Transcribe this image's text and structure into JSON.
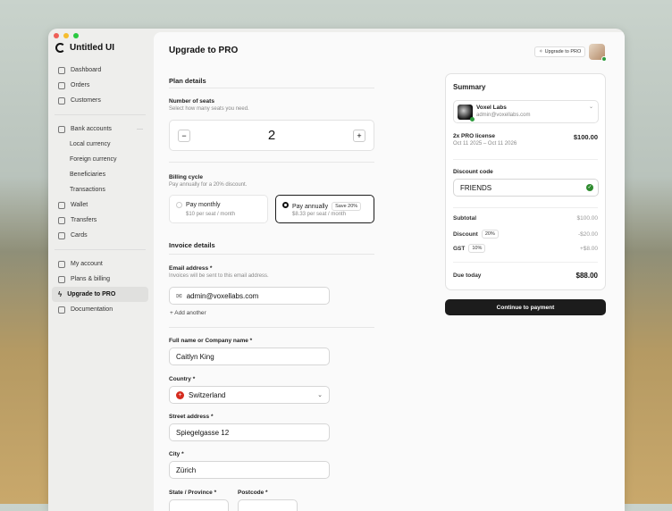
{
  "app": {
    "name": "Untitled UI"
  },
  "sidebar": {
    "items": [
      {
        "label": "Dashboard"
      },
      {
        "label": "Orders"
      },
      {
        "label": "Customers"
      },
      {
        "label": "Bank accounts"
      },
      {
        "label": "Local currency"
      },
      {
        "label": "Foreign currency"
      },
      {
        "label": "Beneficiaries"
      },
      {
        "label": "Transactions"
      },
      {
        "label": "Wallet"
      },
      {
        "label": "Transfers"
      },
      {
        "label": "Cards"
      },
      {
        "label": "My account"
      },
      {
        "label": "Plans & billing"
      },
      {
        "label": "Upgrade to PRO"
      },
      {
        "label": "Documentation"
      }
    ]
  },
  "header": {
    "title": "Upgrade to PRO",
    "upgrade_button": "Upgrade to PRO"
  },
  "plan": {
    "heading": "Plan details",
    "seats_label": "Number of seats",
    "seats_hint": "Select how many seats you need.",
    "seats": "2",
    "minus": "−",
    "plus": "+",
    "billing_label": "Billing cycle",
    "billing_hint": "Pay annually for a 20% discount.",
    "monthly": {
      "title": "Pay monthly",
      "price": "$10 per seat / month"
    },
    "annual": {
      "title": "Pay annually",
      "badge": "Save 20%",
      "price": "$8.33 per seat / month"
    }
  },
  "invoice": {
    "heading": "Invoice details",
    "email_label": "Email address *",
    "email_hint": "Invoices will be sent to this email address.",
    "email": "admin@voxellabs.com",
    "add_another": "Add another",
    "name_label": "Full name or Company name *",
    "name": "Caitlyn King",
    "country_label": "Country *",
    "country": "Switzerland",
    "street_label": "Street address *",
    "street": "Spiegelgasse 12",
    "city_label": "City *",
    "city": "Zürich",
    "state_label": "State / Province *",
    "postcode_label": "Postcode *"
  },
  "summary": {
    "title": "Summary",
    "org": "Voxel Labs",
    "org_email": "admin@voxellabs.com",
    "license": "2x PRO license",
    "license_dates": "Oct 11 2025 – Oct 11 2026",
    "license_price": "$100.00",
    "discount_label": "Discount code",
    "discount_code": "FRIENDS",
    "subtotal_label": "Subtotal",
    "subtotal": "$100.00",
    "discount_row": "Discount",
    "discount_badge": "20%",
    "discount": "-$20.00",
    "gst_label": "GST",
    "gst_badge": "10%",
    "gst": "+$8.00",
    "due_label": "Due today",
    "due": "$88.00",
    "continue": "Continue to payment"
  },
  "colors": {
    "accent": "#1c1c1c",
    "success": "#2e8b2e"
  }
}
